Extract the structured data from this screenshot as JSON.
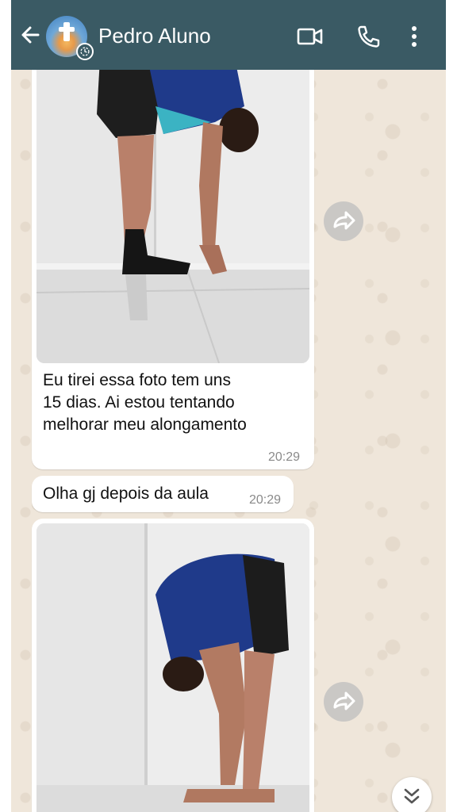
{
  "header": {
    "contact_name": "Pedro Aluno",
    "icons": [
      "back-arrow-icon",
      "avatar",
      "video-call-icon",
      "voice-call-icon",
      "more-options-icon"
    ]
  },
  "messages": [
    {
      "type": "image",
      "caption": "",
      "photo_description_icon": "photo-standing-stretch"
    },
    {
      "type": "text",
      "text_lines": [
        "Eu tirei essa foto tem uns",
        "15 dias. Ai estou tentando",
        "melhorar meu alongamento"
      ],
      "time": "20:29"
    },
    {
      "type": "text",
      "text": "Olha gj depois da aula",
      "time": "20:29"
    },
    {
      "type": "image",
      "caption": "",
      "photo_description_icon": "photo-forward-fold"
    }
  ],
  "controls": {
    "forward_icon": "forward-icon",
    "scroll_icon": "double-chevron-down-icon"
  },
  "colors": {
    "header": "#3a5a64",
    "bubble": "#ffffff",
    "wallpaper": "#efe6da",
    "timestamp": "#8a8a8a"
  }
}
